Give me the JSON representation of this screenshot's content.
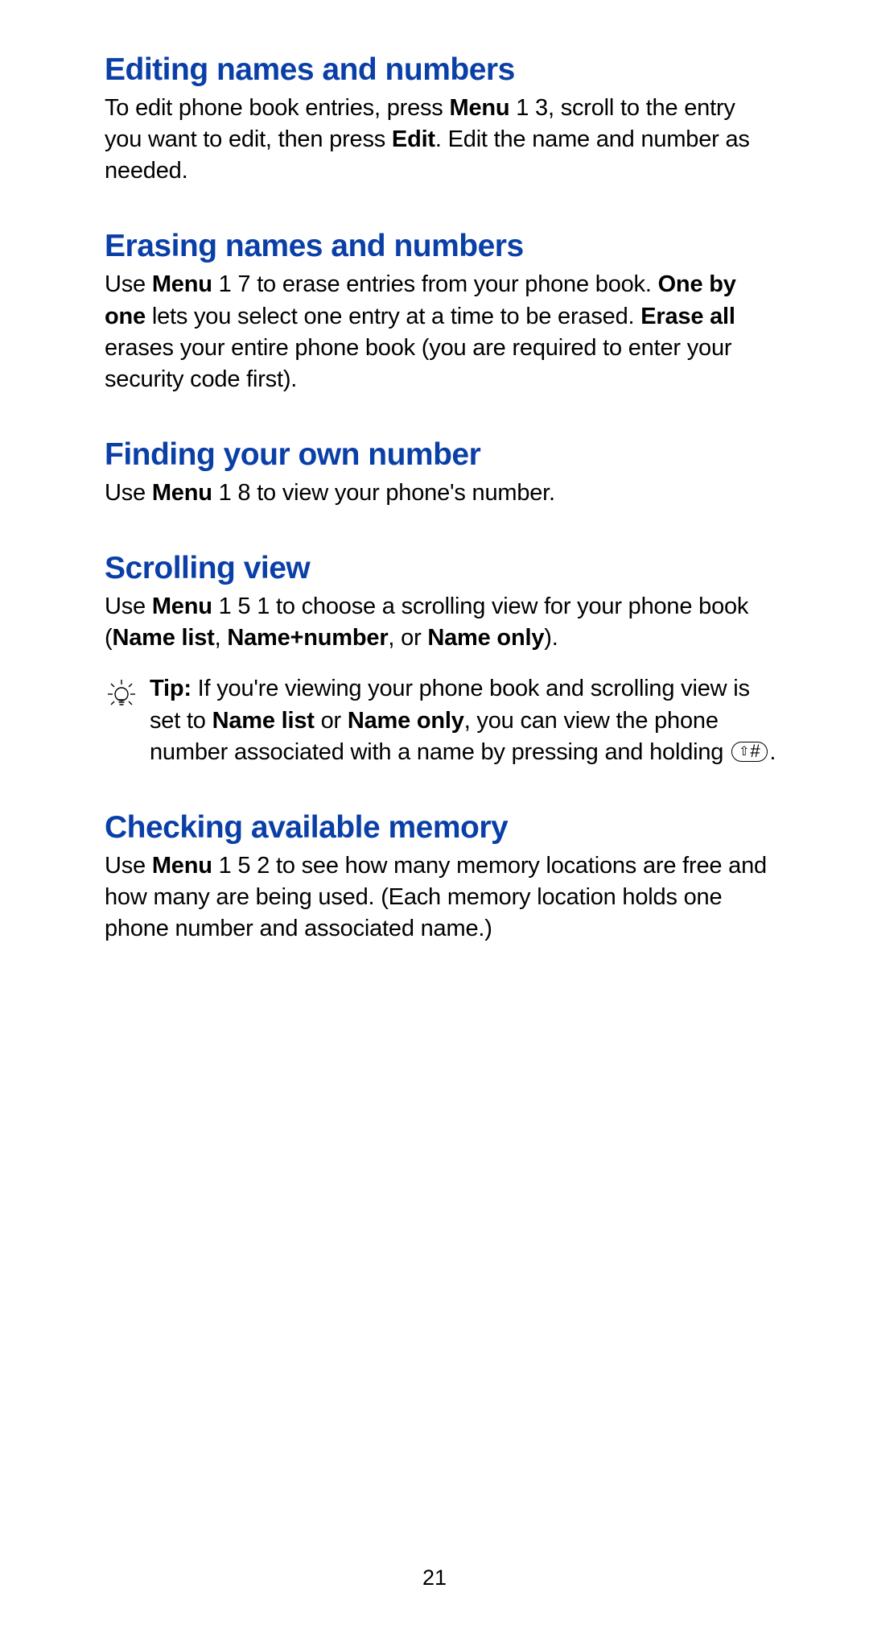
{
  "sections": {
    "editing": {
      "heading": "Editing names and numbers",
      "body_parts": [
        "To edit phone book entries, press ",
        "Menu",
        " 1 3, scroll to the entry you want to edit, then press ",
        "Edit",
        ". Edit the name and number as needed."
      ]
    },
    "erasing": {
      "heading": "Erasing names and numbers",
      "body_parts": [
        "Use ",
        "Menu",
        " 1 7 to erase entries from your phone book. ",
        "One by one",
        " lets you select one entry at a time to be erased. ",
        "Erase all",
        " erases your entire phone book (you are required to enter your security code first)."
      ]
    },
    "finding": {
      "heading": "Finding your own number",
      "body_parts": [
        "Use ",
        "Menu",
        " 1 8 to view your phone's number."
      ]
    },
    "scrolling": {
      "heading": "Scrolling view",
      "body_parts": [
        "Use ",
        "Menu",
        " 1 5 1 to choose a scrolling view for your phone book (",
        "Name list",
        ", ",
        "Name+number",
        ", or ",
        "Name only",
        ")."
      ],
      "tip_parts": [
        "Tip:",
        "  If you're viewing your phone book and scrolling view is set to ",
        "Name list",
        " or ",
        "Name only",
        ", you can view the phone number associated with a name by pressing and holding "
      ]
    },
    "memory": {
      "heading": "Checking available memory",
      "body_parts": [
        "Use ",
        "Menu",
        " 1 5 2 to see how many memory locations are free and how many are being used. (Each memory location holds one phone number and associated name.)"
      ]
    }
  },
  "key_label": "⇧#",
  "page_number": "21"
}
